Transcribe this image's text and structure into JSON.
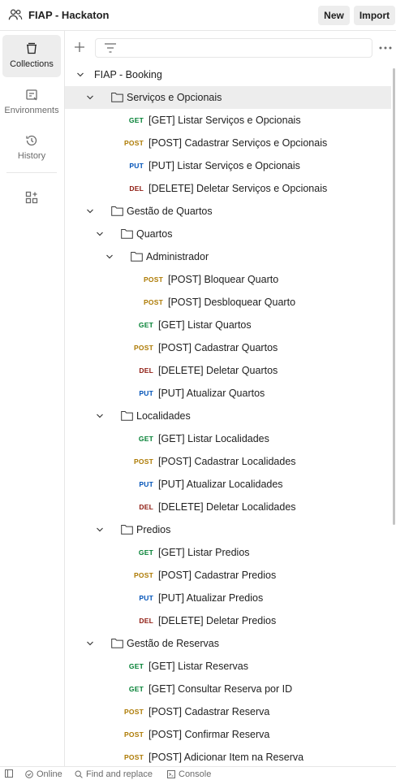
{
  "header": {
    "workspace_title": "FIAP - Hackaton",
    "new_label": "New",
    "import_label": "Import"
  },
  "sidebar": {
    "items": [
      {
        "label": "Collections",
        "icon": "collections-icon",
        "active": true
      },
      {
        "label": "Environments",
        "icon": "environments-icon",
        "active": false
      },
      {
        "label": "History",
        "icon": "history-icon",
        "active": false
      }
    ],
    "apps_icon": "add-apps-icon"
  },
  "toolbar": {
    "search_placeholder": "",
    "new_icon": "plus-icon",
    "filter_icon": "filter-icon",
    "more_icon": "more-icon"
  },
  "tree": {
    "rows": [
      {
        "type": "collection",
        "level": 0,
        "label": "FIAP - Booking"
      },
      {
        "type": "folder",
        "level": 1,
        "label": "Serviços e Opcionais",
        "selected": true
      },
      {
        "type": "request",
        "level": 2,
        "method": "GET",
        "label": "[GET] Listar Serviços e Opcionais"
      },
      {
        "type": "request",
        "level": 2,
        "method": "POST",
        "label": "[POST] Cadastrar Serviços e Opcionais"
      },
      {
        "type": "request",
        "level": 2,
        "method": "PUT",
        "label": "[PUT] Listar Serviços e Opcionais"
      },
      {
        "type": "request",
        "level": 2,
        "method": "DEL",
        "label": "[DELETE] Deletar Serviços e Opcionais"
      },
      {
        "type": "folder",
        "level": 1,
        "label": "Gestão de Quartos"
      },
      {
        "type": "folder",
        "level": 2,
        "label": "Quartos"
      },
      {
        "type": "folder",
        "level": 3,
        "label": "Administrador"
      },
      {
        "type": "request",
        "level": 4,
        "method": "POST",
        "label": "[POST] Bloquear Quarto"
      },
      {
        "type": "request",
        "level": 4,
        "method": "POST",
        "label": "[POST] Desbloquear Quarto"
      },
      {
        "type": "request",
        "level": 3,
        "method": "GET",
        "label": "[GET] Listar Quartos"
      },
      {
        "type": "request",
        "level": 3,
        "method": "POST",
        "label": "[POST] Cadastrar Quartos"
      },
      {
        "type": "request",
        "level": 3,
        "method": "DEL",
        "label": "[DELETE] Deletar Quartos"
      },
      {
        "type": "request",
        "level": 3,
        "method": "PUT",
        "label": "[PUT] Atualizar Quartos"
      },
      {
        "type": "folder",
        "level": 2,
        "label": "Localidades"
      },
      {
        "type": "request",
        "level": 3,
        "method": "GET",
        "label": "[GET] Listar Localidades"
      },
      {
        "type": "request",
        "level": 3,
        "method": "POST",
        "label": "[POST] Cadastrar Localidades"
      },
      {
        "type": "request",
        "level": 3,
        "method": "PUT",
        "label": "[PUT] Atualizar Localidades"
      },
      {
        "type": "request",
        "level": 3,
        "method": "DEL",
        "label": "[DELETE] Deletar Localidades"
      },
      {
        "type": "folder",
        "level": 2,
        "label": "Predios"
      },
      {
        "type": "request",
        "level": 3,
        "method": "GET",
        "label": "[GET] Listar Predios"
      },
      {
        "type": "request",
        "level": 3,
        "method": "POST",
        "label": "[POST] Cadastrar Predios"
      },
      {
        "type": "request",
        "level": 3,
        "method": "PUT",
        "label": "[PUT] Atualizar Predios"
      },
      {
        "type": "request",
        "level": 3,
        "method": "DEL",
        "label": "[DELETE] Deletar Predios"
      },
      {
        "type": "folder",
        "level": 1,
        "label": "Gestão de Reservas"
      },
      {
        "type": "request",
        "level": 2,
        "method": "GET",
        "label": "[GET] Listar Reservas"
      },
      {
        "type": "request",
        "level": 2,
        "method": "GET",
        "label": "[GET] Consultar Reserva por ID"
      },
      {
        "type": "request",
        "level": 2,
        "method": "POST",
        "label": "[POST] Cadastrar Reserva"
      },
      {
        "type": "request",
        "level": 2,
        "method": "POST",
        "label": "[POST] Confirmar Reserva"
      },
      {
        "type": "request",
        "level": 2,
        "method": "POST",
        "label": "[POST] Adicionar Item na Reserva"
      }
    ]
  },
  "statusbar": {
    "online_label": "Online",
    "find_replace_label": "Find and replace",
    "console_label": "Console"
  }
}
